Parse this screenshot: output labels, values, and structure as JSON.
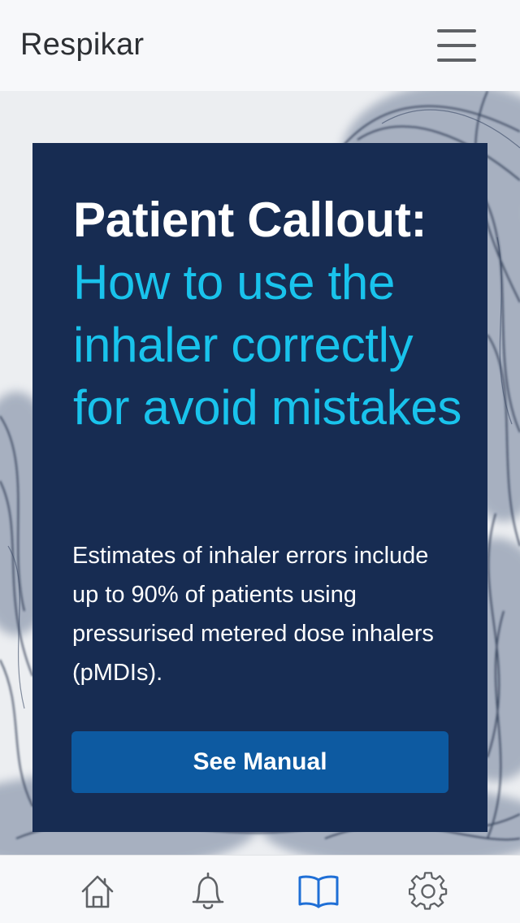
{
  "header": {
    "app_title": "Respikar",
    "menu_icon": "hamburger-menu-icon"
  },
  "hero": {
    "card": {
      "title": "Patient Callout:",
      "subtitle": "How to use the inhaler correctly for avoid mistakes",
      "body": "Estimates of inhaler errors include up to 90% of patients using pressurised metered dose inhalers (pMDIs).",
      "button_label": "See Manual"
    }
  },
  "bottom_nav": {
    "items": [
      {
        "icon": "home-icon",
        "active": false
      },
      {
        "icon": "bell-icon",
        "active": false
      },
      {
        "icon": "book-icon",
        "active": true
      },
      {
        "icon": "gear-icon",
        "active": false
      }
    ]
  },
  "colors": {
    "card_background": "#172c52",
    "accent": "#19c3ec",
    "button": "#0d5aa1",
    "active_nav": "#1f6fd6",
    "inactive_nav": "#5f6266"
  }
}
